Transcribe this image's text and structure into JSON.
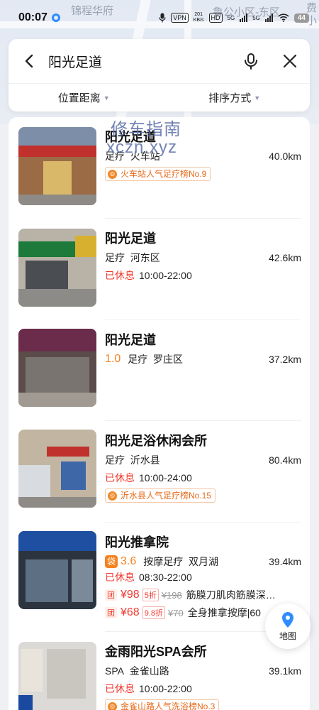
{
  "status_bar": {
    "time": "00:07",
    "vpn": "VPN",
    "net_speed_value": "201",
    "net_speed_unit": "KB/s",
    "hd": "HD",
    "sig1": "5G",
    "sig2": "5G",
    "battery": "44"
  },
  "map": {
    "label_1": "锦程华府",
    "label_2": "鲁公小区-东区",
    "label_3": "费",
    "label_4": "小"
  },
  "search": {
    "query": "阳光足道",
    "back_icon": "back-arrow-icon",
    "mic_icon": "microphone-icon",
    "close_icon": "close-icon"
  },
  "filters": [
    {
      "label": "位置距离"
    },
    {
      "label": "排序方式"
    }
  ],
  "watermark": {
    "line1": "修车指南",
    "line2": "xczn.xyz"
  },
  "results": [
    {
      "title": "阳光足道",
      "category": "足疗",
      "area": "火车站",
      "distance": "40.0km",
      "tag": "火车站人气足疗榜No.9"
    },
    {
      "title": "阳光足道",
      "category": "足疗",
      "area": "河东区",
      "distance": "42.6km",
      "status": "已休息",
      "hours": "10:00-22:00"
    },
    {
      "title": "阳光足道",
      "rating": "1.0",
      "category": "足疗",
      "area": "罗庄区",
      "distance": "37.2km"
    },
    {
      "title": "阳光足浴休闲会所",
      "category": "足疗",
      "area": "沂水县",
      "distance": "80.4km",
      "status": "已休息",
      "hours": "10:00-24:00",
      "tag": "沂水县人气足疗榜No.15"
    },
    {
      "title": "阳光推拿院",
      "rating": "3.6",
      "category": "按摩足疗",
      "area": "双月湖",
      "distance": "39.4km",
      "status": "已休息",
      "hours": "08:30-22:00",
      "deals": [
        {
          "badge": "团",
          "price": "¥98",
          "discount": "5折",
          "original": "¥198",
          "name": "筋膜刀肌肉筋膜深…"
        },
        {
          "badge": "团",
          "price": "¥68",
          "discount": "9.8折",
          "original": "¥70",
          "name": "全身推拿按摩|60"
        }
      ]
    },
    {
      "title": "金雨阳光SPA会所",
      "category": "SPA",
      "area": "金雀山路",
      "distance": "39.1km",
      "status": "已休息",
      "hours": "10:00-22:00",
      "tag": "金雀山路人气洗浴榜No.3"
    }
  ],
  "map_button": {
    "label": "地图",
    "icon": "map-pin-icon"
  },
  "colors": {
    "accent": "#2f8cff",
    "closed": "#ef3a2f",
    "rating": "#f6821f",
    "tag": "#e66a1a"
  }
}
